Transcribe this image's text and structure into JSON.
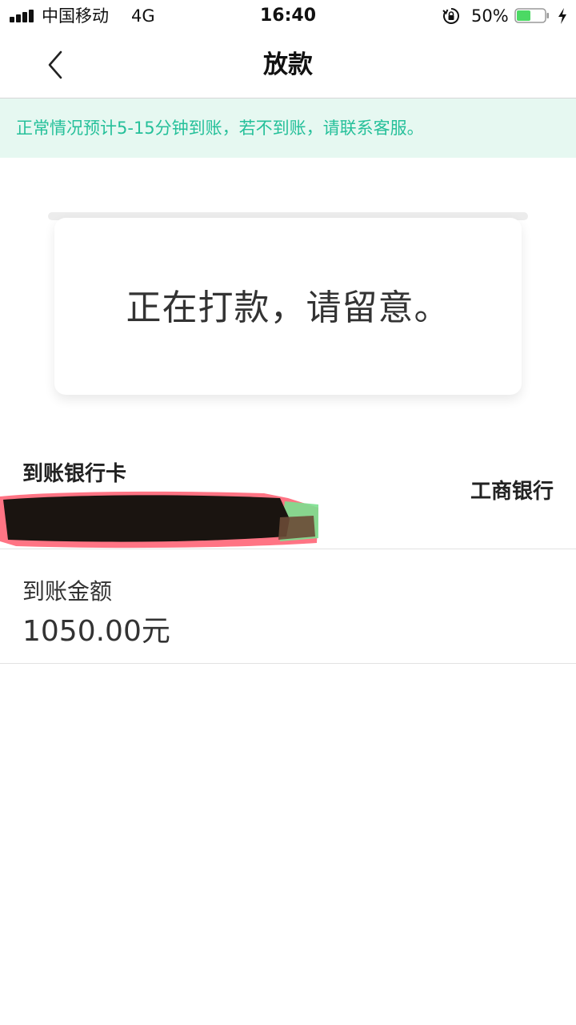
{
  "status_bar": {
    "carrier": "中国移动",
    "network": "4G",
    "time": "16:40",
    "battery_percent": "50%",
    "battery_level": 0.5,
    "battery_color": "#4cd964"
  },
  "nav": {
    "title": "放款",
    "back_icon": "chevron-left-icon"
  },
  "notice": {
    "text": "正常情况预计5-15分钟到账，若不到账，请联系客服。",
    "text_color": "#25c09a",
    "background": "#e6f8f1"
  },
  "status_card": {
    "message": "正在打款，请留意。"
  },
  "bank": {
    "label": "到账银行卡",
    "bank_name": "工商银行"
  },
  "amount": {
    "label": "到账金额",
    "value": "1050.00元"
  }
}
